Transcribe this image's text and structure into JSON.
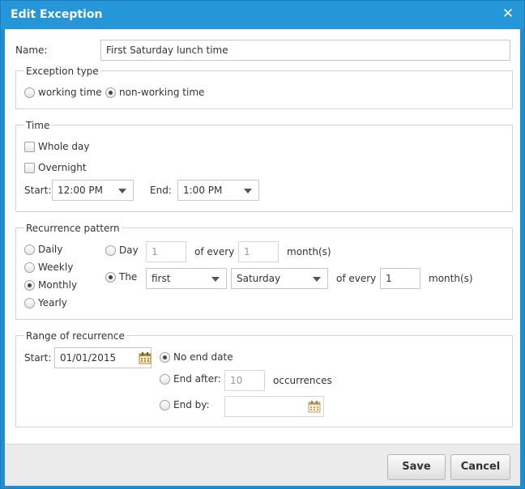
{
  "dialog": {
    "title": "Edit Exception",
    "close_symbol": "✕"
  },
  "name": {
    "label": "Name:",
    "value": "First Saturday lunch time"
  },
  "exception_type": {
    "legend": "Exception type",
    "working_label": "working time",
    "nonworking_label": "non-working time",
    "selected": "non-working time"
  },
  "time": {
    "legend": "Time",
    "whole_day_label": "Whole day",
    "overnight_label": "Overnight",
    "start_label": "Start:",
    "start_value": "12:00 PM",
    "end_label": "End:",
    "end_value": "1:00 PM"
  },
  "recurrence": {
    "legend": "Recurrence pattern",
    "daily_label": "Daily",
    "weekly_label": "Weekly",
    "monthly_label": "Monthly",
    "yearly_label": "Yearly",
    "selected": "Monthly",
    "day_label": "Day",
    "day_value": "1",
    "of_every_label": "of every",
    "day_months_value": "1",
    "months_label": "month(s)",
    "the_label": "The",
    "ordinal_value": "first",
    "weekday_value": "Saturday",
    "the_of_every_label": "of every",
    "the_months_value": "1",
    "the_months_label": "month(s)",
    "selected_option": "The"
  },
  "range": {
    "legend": "Range of recurrence",
    "start_label": "Start:",
    "start_value": "01/01/2015",
    "no_end_label": "No end date",
    "end_after_label": "End after:",
    "end_after_value": "10",
    "occurrences_label": "occurrences",
    "end_by_label": "End by:",
    "end_by_value": "",
    "selected": "No end date"
  },
  "footer": {
    "save_label": "Save",
    "cancel_label": "Cancel"
  },
  "colors": {
    "titlebar": "#2596d8",
    "calendar_icon": "#b08a2e"
  }
}
